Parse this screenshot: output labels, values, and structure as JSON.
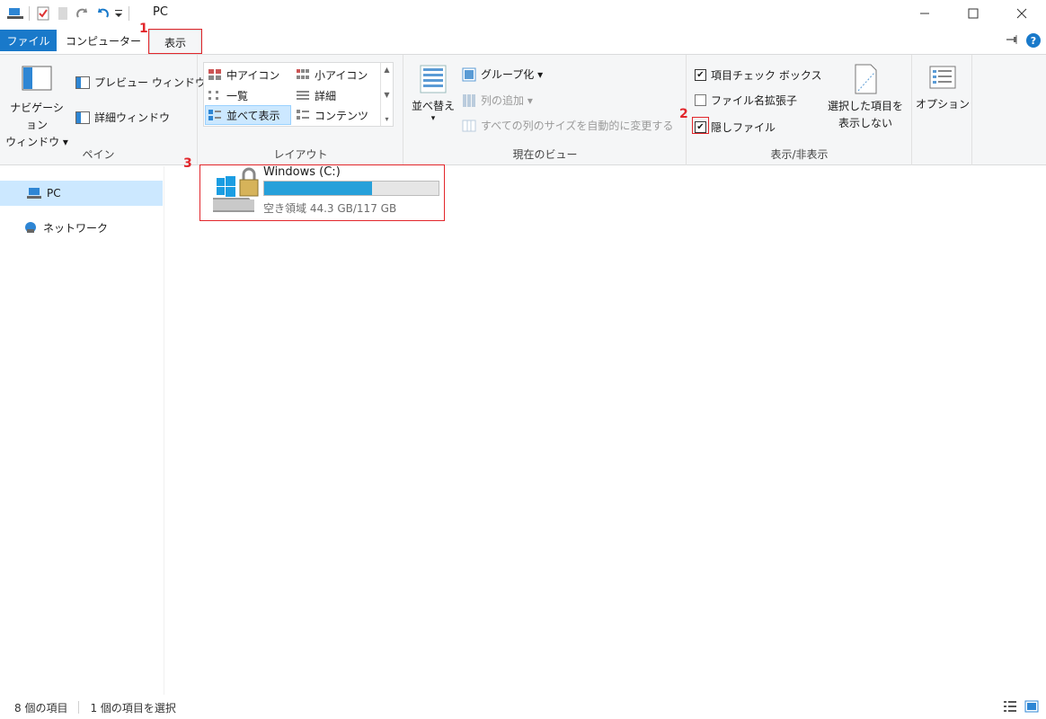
{
  "window": {
    "title": "PC"
  },
  "tabs": {
    "file": "ファイル",
    "computer": "コンピューター",
    "view": "表示"
  },
  "annotations": {
    "n1": "1",
    "n2": "2",
    "n3": "3"
  },
  "ribbon": {
    "pane": {
      "label": "ペイン",
      "navigation": "ナビゲーション\nウィンドウ",
      "navigation_line1": "ナビゲーション",
      "navigation_line2": "ウィンドウ ▾",
      "preview": "プレビュー ウィンドウ",
      "details": "詳細ウィンドウ"
    },
    "layout": {
      "label": "レイアウト",
      "items": [
        "中アイコン",
        "小アイコン",
        "一覧",
        "詳細",
        "並べて表示",
        "コンテンツ"
      ]
    },
    "current_view": {
      "label": "現在のビュー",
      "sort_line1": "並べ替え",
      "sort_line2": "▾",
      "group": "グループ化 ▾",
      "add_column": "列の追加 ▾",
      "autosize": "すべての列のサイズを自動的に変更する"
    },
    "show_hide": {
      "label": "表示/非表示",
      "item_checkboxes": "項目チェック ボックス",
      "file_extensions": "ファイル名拡張子",
      "hidden_items": "隠しファイル",
      "hide_selected_line1": "選択した項目を",
      "hide_selected_line2": "表示しない"
    },
    "options": {
      "label": "オプション"
    }
  },
  "navpane": {
    "items": [
      "PC",
      "ネットワーク"
    ]
  },
  "drive": {
    "name": "Windows (C:)",
    "free_text": "空き領域 44.3 GB/117 GB",
    "used_fraction": 0.62
  },
  "status": {
    "count": "8 個の項目",
    "selected": "1 個の項目を選択"
  },
  "colors": {
    "accent": "#1979ca",
    "highlight": "#e2262b",
    "drive_fill": "#26a0da"
  }
}
